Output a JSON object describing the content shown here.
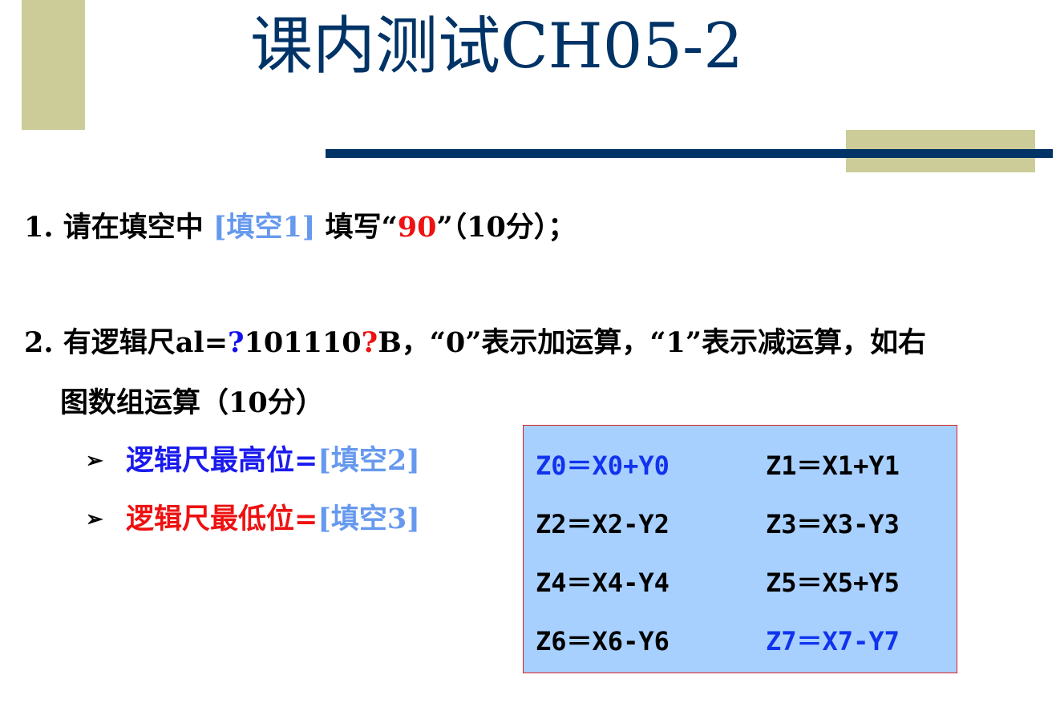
{
  "slide": {
    "title": "课内测试CH05-2",
    "q1": {
      "prefix": "1. 请在填空中 ",
      "blank": "[填空1]",
      "middle": " 填写“",
      "answer": "90",
      "suffix": "”（10分）；"
    },
    "q2": {
      "line1_a": "2. 有逻辑尺al=",
      "mark1": "?",
      "line1_b": "101110",
      "mark2": "?",
      "line1_c": "B，“0”表示加运算，“1”表示减运算，如右",
      "line2": "图数组运算（10分）"
    },
    "bullets": [
      {
        "arrow": "➢",
        "text": "逻辑尺最高位=",
        "blank": "[填空2]"
      },
      {
        "arrow": "➢",
        "text": "逻辑尺最低位=",
        "blank": "[填空3]"
      }
    ],
    "formulas": [
      "Z0＝X0+Y0",
      "Z1＝X1+Y1",
      "Z2＝X2-Y2",
      "Z3＝X3-Y3",
      "Z4＝X4-Y4",
      "Z5＝X5+Y5",
      "Z6＝X6-Y6",
      "Z7＝X7-Y7"
    ],
    "colors": {
      "title": "#003366",
      "accent_bar": "#cccc99",
      "rule": "#003366",
      "blank": "#6699ee",
      "highlight_red": "#ee1111",
      "highlight_blue": "#1111ee",
      "box_fill": "#a8d0ff",
      "box_border": "#dd2222"
    }
  }
}
